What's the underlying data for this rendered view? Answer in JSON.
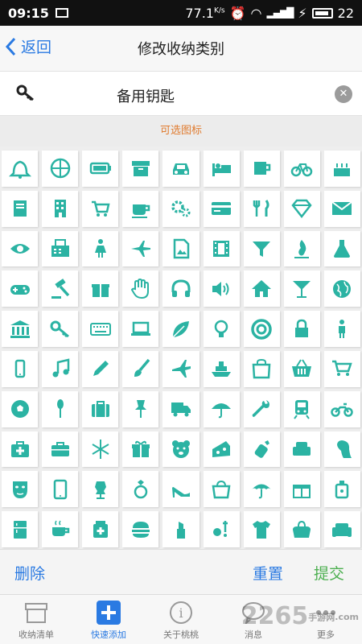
{
  "status_bar": {
    "time": "09:15",
    "speed": "77.1",
    "speed_unit": "K/s",
    "battery": "22"
  },
  "nav": {
    "back_label": "返回",
    "title": "修改收纳类别"
  },
  "input": {
    "value": "备用钥匙",
    "icon": "key-icon"
  },
  "section_label": "可选图标",
  "icon_color": "#2bb3a3",
  "icons": [
    "bell",
    "basketball",
    "battery",
    "archive-box",
    "car",
    "bed",
    "cup",
    "bicycle",
    "birthday-cake",
    "book",
    "building",
    "shopping-cart",
    "coffee-cup",
    "gears",
    "credit-card",
    "fork-knife",
    "diamond",
    "envelope",
    "eye",
    "fax",
    "female",
    "airplane",
    "image-file",
    "film",
    "filter",
    "fire",
    "flask",
    "gamepad",
    "gavel",
    "gift",
    "hand",
    "headphones",
    "volume",
    "home",
    "cocktail",
    "globe",
    "bank",
    "key",
    "keyboard",
    "laptop",
    "leaf",
    "lightbulb",
    "lifebuoy",
    "lock",
    "male",
    "mobile-phone",
    "music-note",
    "pencil",
    "paintbrush",
    "plane",
    "ship",
    "shopping-bag",
    "basket",
    "cart",
    "soccer-ball",
    "spoon",
    "suitcase",
    "pushpin",
    "truck",
    "umbrella",
    "wrench",
    "train",
    "motorcycle",
    "medical-kit",
    "briefcase",
    "snowflake",
    "gift-box",
    "teddy-bear",
    "cheese",
    "baby-bottle",
    "armchair",
    "woman-hair",
    "face-mask",
    "tablet",
    "dress-form",
    "ring",
    "high-heel",
    "handbag",
    "umbrella-open",
    "present",
    "perfume",
    "fridge",
    "tea-cup",
    "medicine-box",
    "burger",
    "lipstick",
    "badminton",
    "t-shirt",
    "purse",
    "sofa"
  ],
  "actions": {
    "delete": "删除",
    "reset": "重置",
    "submit": "提交"
  },
  "tabs": [
    {
      "label": "收纳清单",
      "icon": "box-icon",
      "active": false
    },
    {
      "label": "快速添加",
      "icon": "plus-icon",
      "active": true
    },
    {
      "label": "关于桃桃",
      "icon": "info-icon",
      "active": false
    },
    {
      "label": "消息",
      "icon": "chat-icon",
      "active": false
    },
    {
      "label": "更多",
      "icon": "more-icon",
      "active": false
    }
  ],
  "watermark": {
    "text": "2265",
    "suffix": "手游网",
    "url": ".com"
  }
}
